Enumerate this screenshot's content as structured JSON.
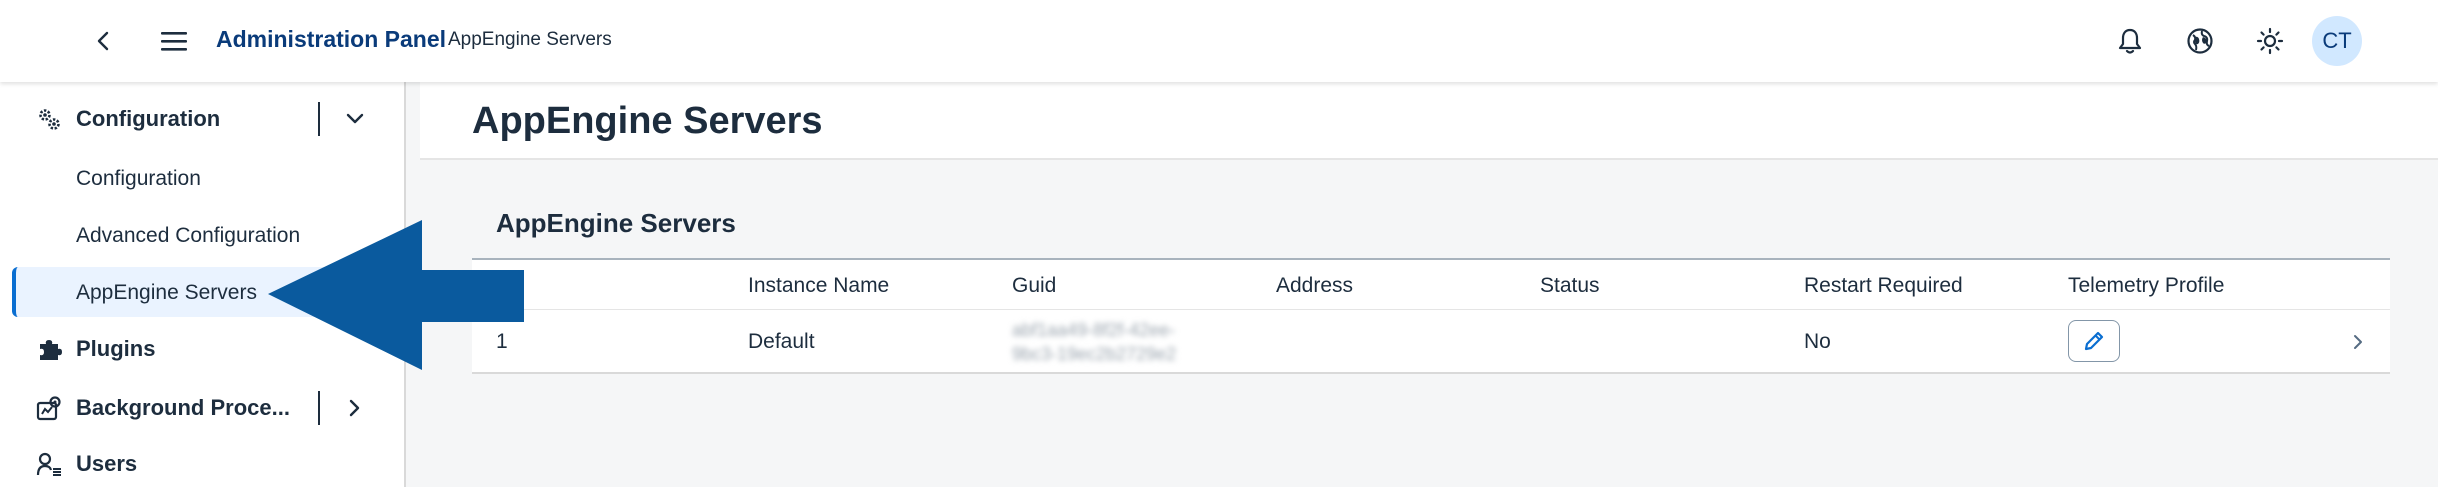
{
  "header": {
    "brand": "Administration Panel",
    "subtitle": "AppEngine Servers",
    "avatar_initials": "CT",
    "icons": [
      "back-icon",
      "menu-icon",
      "bell-icon",
      "globe-icon",
      "sun-icon"
    ]
  },
  "sidebar": {
    "groups": [
      {
        "label": "Configuration",
        "icon": "gears-icon",
        "expanded": true
      },
      {
        "label": "Plugins",
        "icon": "puzzle-icon"
      },
      {
        "label": "Background Proce...",
        "icon": "background-process-icon",
        "expanded": false
      },
      {
        "label": "Users",
        "icon": "users-icon"
      }
    ],
    "sub_items": [
      {
        "label": "Configuration"
      },
      {
        "label": "Advanced Configuration"
      },
      {
        "label": "AppEngine Servers",
        "selected": true
      }
    ]
  },
  "page": {
    "title": "AppEngine Servers"
  },
  "table": {
    "title": "AppEngine Servers",
    "columns": [
      "Instance Name",
      "Guid",
      "Address",
      "Status",
      "Restart Required",
      "Telemetry Profile"
    ],
    "rows": [
      {
        "index": "1",
        "instance_name": "Default",
        "guid_line1": "abf1aa49-8f2f-42ee-",
        "guid_line2": "9bc3-19ec2b2729e2",
        "address": "",
        "status": "",
        "restart_required": "No"
      }
    ]
  },
  "colors": {
    "brand": "#0a3b7a",
    "accent": "#0a6ed1",
    "arrow": "#0a5a9e",
    "selected_bg": "#eaf3ff"
  }
}
